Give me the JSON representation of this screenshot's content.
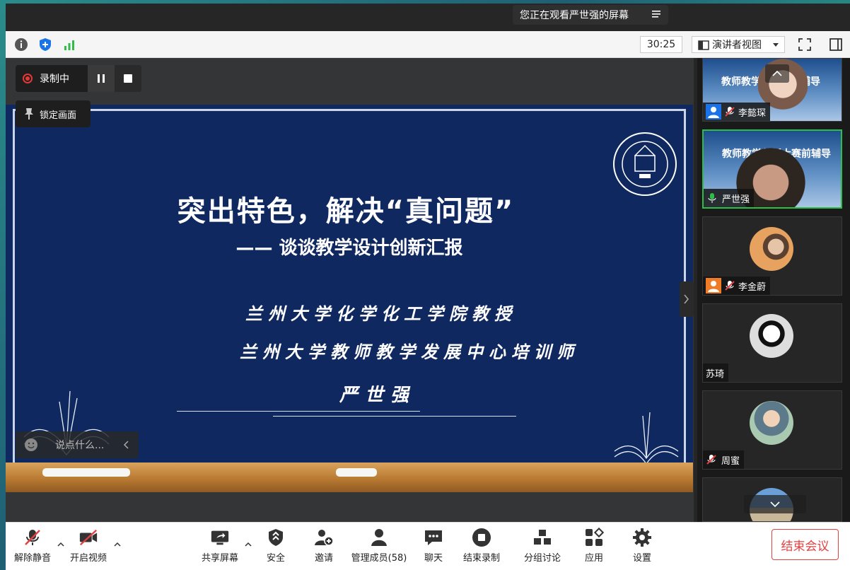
{
  "banner": {
    "text": "您正在观看严世强的屏幕"
  },
  "topbar": {
    "timer": "30:25",
    "view_mode": "演讲者视图"
  },
  "recording": {
    "label": "录制中"
  },
  "lock_view": {
    "label": "锁定画面"
  },
  "slide": {
    "title": "突出特色，解决“真问题”",
    "subtitle": "—— 谈谈教学设计创新汇报",
    "line1": "兰州大学化学化工学院教授",
    "line2": "兰州大学教师教学发展中心培训师",
    "speaker": "严世强"
  },
  "chat": {
    "placeholder": "说点什么..."
  },
  "participants": [
    {
      "name": "李懿琛",
      "status": "screen"
    },
    {
      "name": "严世强",
      "status": "speaking"
    },
    {
      "name": "李金蔚",
      "status": "muted"
    },
    {
      "name": "苏琦",
      "status": "none"
    },
    {
      "name": "周蜜",
      "status": "muted"
    }
  ],
  "toolbar": {
    "mute": "解除静音",
    "video": "开启视频",
    "share": "共享屏幕",
    "security": "安全",
    "invite": "邀请",
    "members": "管理成员(58)",
    "chat": "聊天",
    "end_record": "结束录制",
    "breakout": "分组讨论",
    "apps": "应用",
    "settings": "设置",
    "end_meeting": "结束会议"
  },
  "colors": {
    "accent_red": "#e34040",
    "active_green": "#2fbd4a",
    "slide_bg": "#0f2860"
  }
}
